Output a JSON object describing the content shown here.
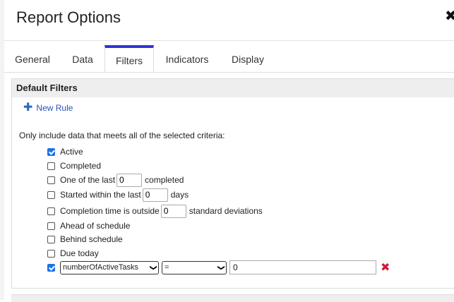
{
  "dialog": {
    "title": "Report Options"
  },
  "tabs": [
    {
      "label": "General"
    },
    {
      "label": "Data"
    },
    {
      "label": "Filters"
    },
    {
      "label": "Indicators"
    },
    {
      "label": "Display"
    }
  ],
  "panel": {
    "heading": "Default Filters",
    "new_rule_label": "New Rule",
    "intro": "Only include data that meets all of the selected criteria:",
    "criteria": {
      "active": {
        "label": "Active",
        "checked": true
      },
      "completed": {
        "label": "Completed",
        "checked": false
      },
      "one_of_last": {
        "label_before": "One of the last",
        "value": "0",
        "label_after": "completed",
        "checked": false
      },
      "started_within": {
        "label_before": "Started within the last",
        "value": "0",
        "label_after": "days",
        "checked": false
      },
      "completion_time": {
        "label_before": "Completion time is outside",
        "value": "0",
        "label_after": "standard deviations",
        "checked": false
      },
      "ahead": {
        "label": "Ahead of schedule",
        "checked": false
      },
      "behind": {
        "label": "Behind schedule",
        "checked": false
      },
      "due_today": {
        "label": "Due today",
        "checked": false
      }
    },
    "custom_rule": {
      "checked": true,
      "field": "numberOfActiveTasks",
      "operator": "=",
      "value": "0"
    }
  },
  "colors": {
    "accent": "#3232d6",
    "link": "#2a52be",
    "delete": "#d21c34",
    "checkbox": "#1a73e8"
  }
}
